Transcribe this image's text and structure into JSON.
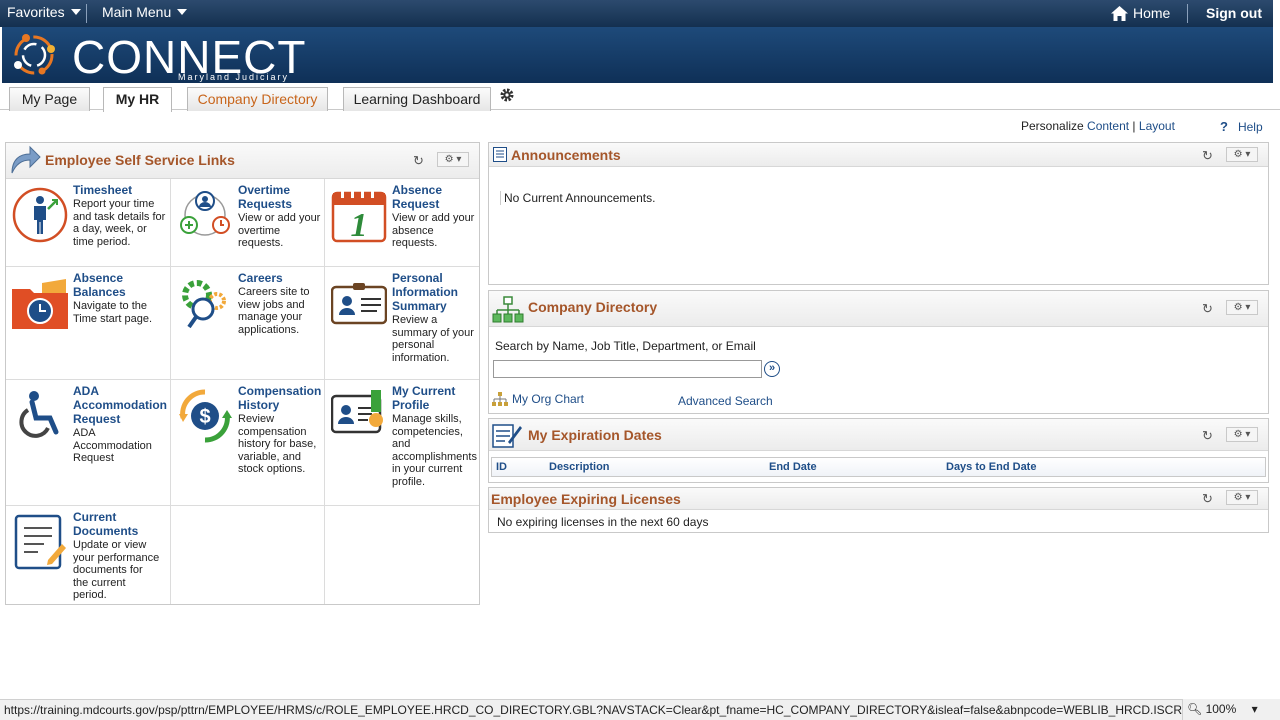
{
  "topbar": {
    "favorites": "Favorites",
    "main_menu": "Main Menu",
    "home": "Home",
    "sign_out": "Sign out"
  },
  "banner": {
    "logo_text": "CONNECT",
    "logo_sub": "Maryland Judiciary"
  },
  "tabs": [
    "My Page",
    "My HR",
    "Company Directory",
    "Learning Dashboard"
  ],
  "personalize": {
    "label": "Personalize",
    "content": "Content",
    "separator": "|",
    "layout": "Layout",
    "help_icon": "?",
    "help": "Help"
  },
  "ess": {
    "title": "Employee Self Service Links",
    "items": [
      {
        "title": "Timesheet",
        "desc": "Report your time and task details for a day, week, or time period.",
        "icon": "timesheet-icon"
      },
      {
        "title": "Overtime Requests",
        "desc": "View or add your overtime requests.",
        "icon": "overtime-icon"
      },
      {
        "title": "Absence Request",
        "desc": "View or add your absence requests.",
        "icon": "calendar-icon",
        "icon_text": "1"
      },
      {
        "title": "Absence Balances",
        "desc": "Navigate to the Time start page.",
        "icon": "folder-clock-icon"
      },
      {
        "title": "Careers",
        "desc": "Careers site to view jobs and manage your applications.",
        "icon": "gear-search-icon"
      },
      {
        "title": "Personal Information Summary",
        "desc": "Review a summary of your personal information.",
        "icon": "id-card-icon"
      },
      {
        "title": "ADA Accommodation Request",
        "desc": "ADA Accommodation Request",
        "icon": "wheelchair-icon"
      },
      {
        "title": "Compensation History",
        "desc": "Review compensation history for base, variable, and stock options.",
        "icon": "dollar-cycle-icon",
        "icon_text": "$"
      },
      {
        "title": "My Current Profile",
        "desc": "Manage skills, competencies, and accomplishments in your current profile.",
        "icon": "profile-badge-icon"
      },
      {
        "title": "Current Documents",
        "desc": "Update or view your performance documents for the current period.",
        "icon": "document-pen-icon"
      }
    ]
  },
  "announcements": {
    "title": "Announcements",
    "text": "No Current Announcements."
  },
  "directory": {
    "title": "Company Directory",
    "search_label": "Search by Name, Job Title, Department, or Email",
    "search_value": "",
    "go_icon": "»",
    "org_chart": "My Org Chart",
    "advanced": "Advanced Search"
  },
  "expiration": {
    "title": "My Expiration Dates",
    "columns": [
      "ID",
      "Description",
      "End Date",
      "Days to End Date"
    ]
  },
  "licenses": {
    "title": "Employee Expiring Licenses",
    "text": "No expiring licenses in the next 60 days"
  },
  "statusbar": {
    "url": "https://training.mdcourts.gov/psp/pttrn/EMPLOYEE/HRMS/c/ROLE_EMPLOYEE.HRCD_CO_DIRECTORY.GBL?NAVSTACK=Clear&pt_fname=HC_COMPANY_DIRECTORY&isleaf=false&abnpcode=WEBLIB_HRCD.ISCRIPT1.Field",
    "zoom": "100%"
  },
  "colors": {
    "topbar": "#14304f",
    "banner": "#1e4a7a",
    "title": "#a5562a",
    "link": "#1f4e88",
    "tab_orange": "#c8651b"
  }
}
